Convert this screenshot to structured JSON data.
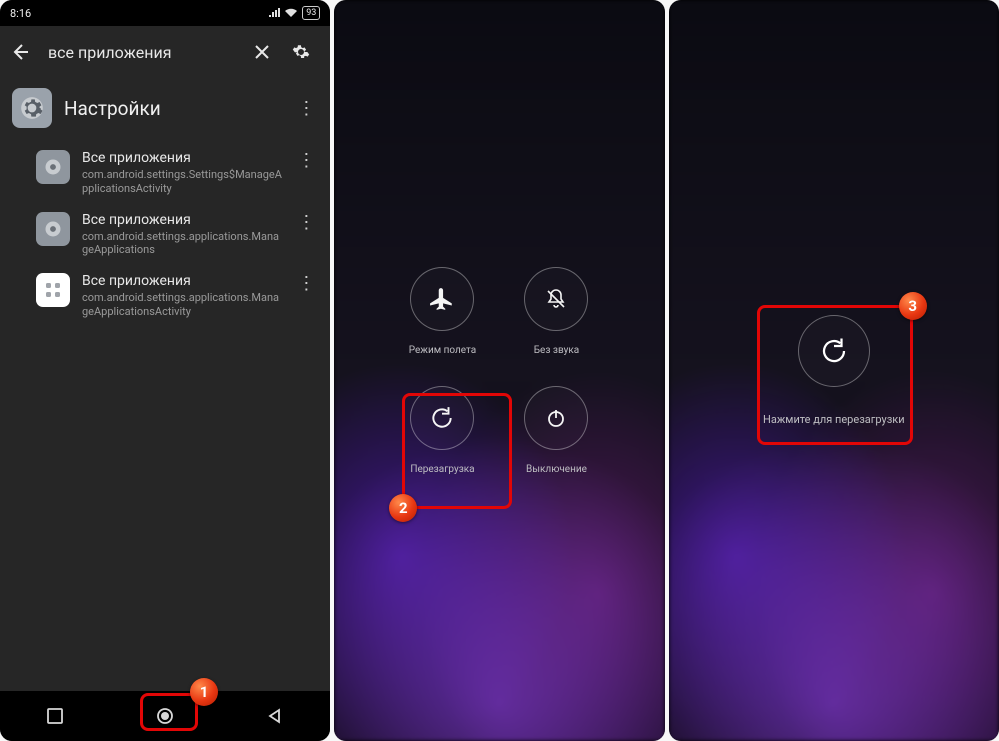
{
  "status": {
    "time": "8:16",
    "battery": "93"
  },
  "toolbar": {
    "title": "все приложения"
  },
  "section": {
    "title": "Настройки",
    "icon": "gear-icon"
  },
  "rows": [
    {
      "title": "Все приложения",
      "sub": "com.android.settings.Settings$ManageApplicationsActivity",
      "icon": "gear"
    },
    {
      "title": "Все приложения",
      "sub": "com.android.settings.applications.ManageApplications",
      "icon": "gear"
    },
    {
      "title": "Все приложения",
      "sub": "com.android.settings.applications.ManageApplicationsActivity",
      "icon": "grid"
    }
  ],
  "power": {
    "airplane": "Режим полета",
    "silent": "Без звука",
    "reboot": "Перезагрузка",
    "shutdown": "Выключение",
    "tap_to_reboot": "Нажмите для перезагрузки"
  },
  "callouts": {
    "n1": "1",
    "n2": "2",
    "n3": "3"
  }
}
